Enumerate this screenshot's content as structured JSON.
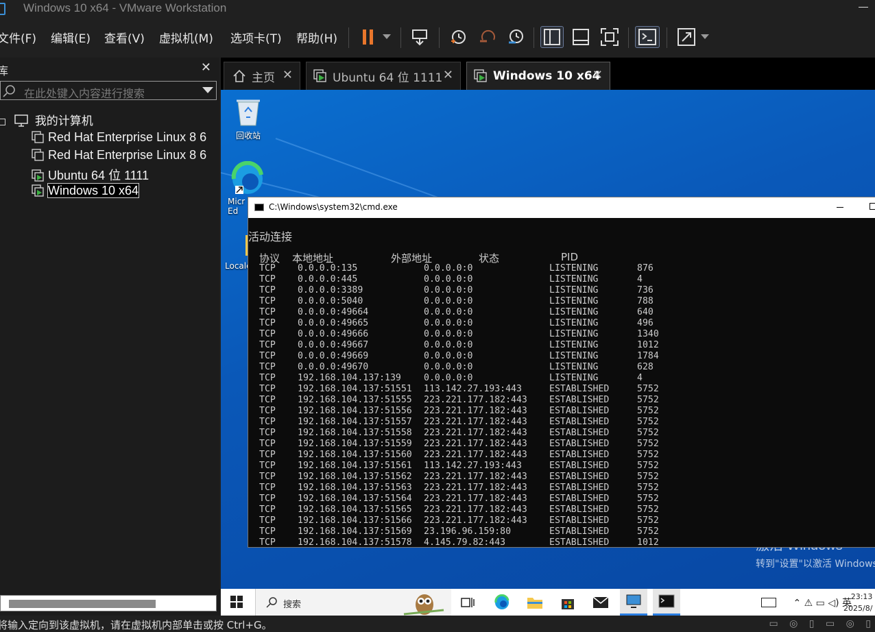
{
  "window": {
    "title": "Windows 10 x64 - VMware Workstation"
  },
  "menu": [
    "文件(F)",
    "编辑(E)",
    "查看(V)",
    "虚拟机(M)",
    "选项卡(T)",
    "帮助(H)"
  ],
  "toolbar": {
    "icons": [
      "pause-icon",
      "dropdown-icon",
      "send-ctrl-alt-del-icon",
      "snapshot-icon",
      "revert-snapshot-icon",
      "snapshot-manager-icon",
      "show-library-icon",
      "thumbnail-bar-icon",
      "fullscreen-icon",
      "console-view-icon",
      "stretch-icon",
      "dropdown-icon"
    ]
  },
  "library": {
    "title": "库",
    "search_placeholder": "在此处键入内容进行搜索",
    "root_label": "我的计算机",
    "items": [
      {
        "label": "Red Hat Enterprise Linux 8 6"
      },
      {
        "label": "Red Hat Enterprise Linux 8 6"
      },
      {
        "label": "Ubuntu 64 位 1111"
      },
      {
        "label": "Windows 10 x64"
      }
    ]
  },
  "tabs": [
    {
      "label": "主页"
    },
    {
      "label": "Ubuntu 64 位 1111"
    },
    {
      "label": "Windows 10 x64"
    }
  ],
  "desktop": {
    "icons": [
      {
        "label": "回收站"
      },
      {
        "label": "Micr​Ed"
      },
      {
        "label": "Localc"
      }
    ],
    "watermark_title": "激活 Windows",
    "watermark_sub": "转到\"设置\"以激活 Windows"
  },
  "cmd": {
    "title": "C:\\Windows\\system32\\cmd.exe",
    "heading": "活动连接",
    "headers": [
      "协议",
      "本地地址",
      "外部地址",
      "状态",
      "PID"
    ],
    "rows": [
      [
        "TCP",
        "0.0.0.0:135",
        "0.0.0.0:0",
        "LISTENING",
        "876"
      ],
      [
        "TCP",
        "0.0.0.0:445",
        "0.0.0.0:0",
        "LISTENING",
        "4"
      ],
      [
        "TCP",
        "0.0.0.0:3389",
        "0.0.0.0:0",
        "LISTENING",
        "736"
      ],
      [
        "TCP",
        "0.0.0.0:5040",
        "0.0.0.0:0",
        "LISTENING",
        "788"
      ],
      [
        "TCP",
        "0.0.0.0:49664",
        "0.0.0.0:0",
        "LISTENING",
        "640"
      ],
      [
        "TCP",
        "0.0.0.0:49665",
        "0.0.0.0:0",
        "LISTENING",
        "496"
      ],
      [
        "TCP",
        "0.0.0.0:49666",
        "0.0.0.0:0",
        "LISTENING",
        "1340"
      ],
      [
        "TCP",
        "0.0.0.0:49667",
        "0.0.0.0:0",
        "LISTENING",
        "1012"
      ],
      [
        "TCP",
        "0.0.0.0:49669",
        "0.0.0.0:0",
        "LISTENING",
        "1784"
      ],
      [
        "TCP",
        "0.0.0.0:49670",
        "0.0.0.0:0",
        "LISTENING",
        "628"
      ],
      [
        "TCP",
        "192.168.104.137:139",
        "0.0.0.0:0",
        "LISTENING",
        "4"
      ],
      [
        "TCP",
        "192.168.104.137:51551",
        "113.142.27.193:443",
        "ESTABLISHED",
        "5752"
      ],
      [
        "TCP",
        "192.168.104.137:51555",
        "223.221.177.182:443",
        "ESTABLISHED",
        "5752"
      ],
      [
        "TCP",
        "192.168.104.137:51556",
        "223.221.177.182:443",
        "ESTABLISHED",
        "5752"
      ],
      [
        "TCP",
        "192.168.104.137:51557",
        "223.221.177.182:443",
        "ESTABLISHED",
        "5752"
      ],
      [
        "TCP",
        "192.168.104.137:51558",
        "223.221.177.182:443",
        "ESTABLISHED",
        "5752"
      ],
      [
        "TCP",
        "192.168.104.137:51559",
        "223.221.177.182:443",
        "ESTABLISHED",
        "5752"
      ],
      [
        "TCP",
        "192.168.104.137:51560",
        "223.221.177.182:443",
        "ESTABLISHED",
        "5752"
      ],
      [
        "TCP",
        "192.168.104.137:51561",
        "113.142.27.193:443",
        "ESTABLISHED",
        "5752"
      ],
      [
        "TCP",
        "192.168.104.137:51562",
        "223.221.177.182:443",
        "ESTABLISHED",
        "5752"
      ],
      [
        "TCP",
        "192.168.104.137:51563",
        "223.221.177.182:443",
        "ESTABLISHED",
        "5752"
      ],
      [
        "TCP",
        "192.168.104.137:51564",
        "223.221.177.182:443",
        "ESTABLISHED",
        "5752"
      ],
      [
        "TCP",
        "192.168.104.137:51565",
        "223.221.177.182:443",
        "ESTABLISHED",
        "5752"
      ],
      [
        "TCP",
        "192.168.104.137:51566",
        "223.221.177.182:443",
        "ESTABLISHED",
        "5752"
      ],
      [
        "TCP",
        "192.168.104.137:51569",
        "23.196.96.159:80",
        "ESTABLISHED",
        "5752"
      ],
      [
        "TCP",
        "192.168.104.137:51578",
        "4.145.79.82:443",
        "ESTABLISHED",
        "1012"
      ]
    ]
  },
  "taskbar": {
    "search_label": "搜索",
    "tray_lang": "英",
    "time": "23:13",
    "date": "2025/8/"
  },
  "statusbar": {
    "text": "将输入定向到该虚拟机，请在虚拟机内部单击或按 Ctrl+G。"
  },
  "colors": {
    "accent": "#0a6fd0",
    "pause": "#e8762b",
    "play": "#3cb043"
  }
}
